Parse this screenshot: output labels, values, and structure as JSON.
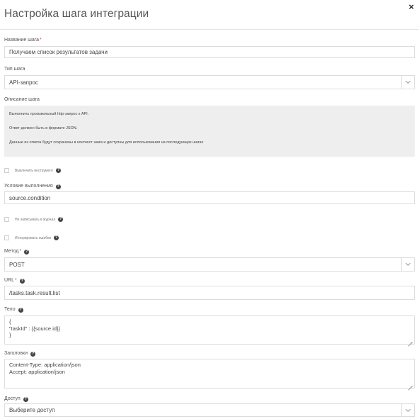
{
  "dialog": {
    "title": "Настройка шага интеграции",
    "close_glyph": "×"
  },
  "step_name": {
    "label": "Название шага",
    "required_mark": "*",
    "value": "Получаем список результатов задачи"
  },
  "step_type": {
    "label": "Тип шага",
    "value": "API-запрос"
  },
  "description": {
    "label": "Описание шага",
    "lines": [
      "Выполнить произвольный http-запрос к API.",
      "Ответ должен быть в формате JSON.",
      "Данные из ответа будут сохранены в контекст шага и доступны для использования на последующих шагах"
    ]
  },
  "disable_tool": {
    "label": "Выключить инструмент",
    "help_glyph": "?"
  },
  "condition": {
    "label": "Условие выполнения",
    "help_glyph": "?",
    "value": "source.condition"
  },
  "no_log": {
    "label": "Не записывать в журнал",
    "help_glyph": "?"
  },
  "ignore_errors": {
    "label": "Игнорировать ошибки",
    "help_glyph": "?"
  },
  "method": {
    "label": "Метод",
    "required_mark": "*",
    "help_glyph": "?",
    "value": "POST"
  },
  "url": {
    "label": "URL",
    "required_mark": "*",
    "help_glyph": "?",
    "value": "/tasks.task.result.list"
  },
  "body": {
    "label": "Тело",
    "help_glyph": "?",
    "lines": [
      "{",
      "\"taskId\" : {{source.id}}",
      "}"
    ]
  },
  "headers": {
    "label": "Заголовки",
    "help_glyph": "?",
    "lines": [
      "Content-Type: application/json",
      "Accept: application/json"
    ]
  },
  "access": {
    "label": "Доступ",
    "help_glyph": "?",
    "placeholder": "Выберите доступ"
  }
}
